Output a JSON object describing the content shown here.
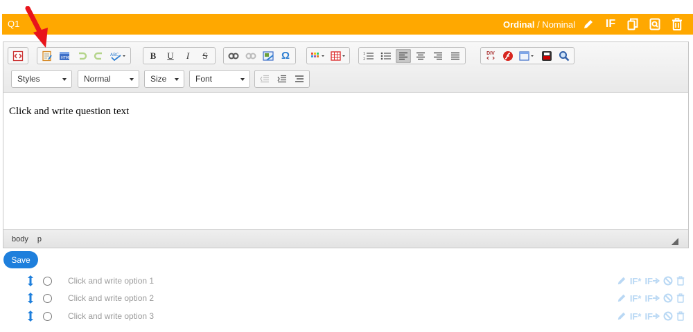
{
  "question": {
    "label": "Q1",
    "type_bold": "Ordinal",
    "type_rest": " / Nominal",
    "if_label": "IF"
  },
  "editor": {
    "combos": {
      "styles": "Styles",
      "format": "Normal",
      "size": "Size",
      "font": "Font"
    },
    "toolbar": {
      "bold": "B",
      "underline": "U",
      "italic": "I",
      "strike": "S",
      "special_char": "Ω",
      "div": "DIV"
    },
    "content": "Click and write question text",
    "status": [
      "body",
      "p"
    ]
  },
  "save_label": "Save",
  "options": [
    {
      "text": "Click and write option 1"
    },
    {
      "text": "Click and write option 2"
    },
    {
      "text": "Click and write option 3"
    }
  ],
  "option_icons": {
    "if_star": "IF*",
    "if_arrow": "IF"
  },
  "colors": {
    "header": "#ffa800",
    "save": "#1e7fdc",
    "arrow": "#e8141b",
    "faded_icon": "#b9d8f4"
  }
}
